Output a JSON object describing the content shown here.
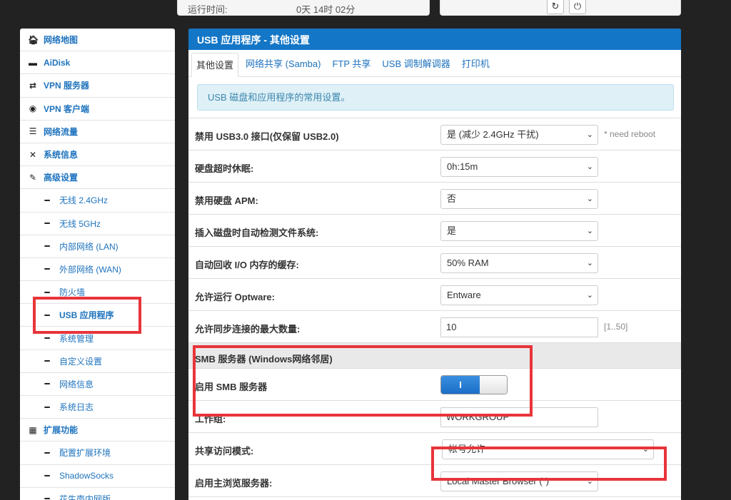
{
  "status": {
    "uptime_label": "运行时间:",
    "uptime_value": "0天 14时 02分",
    "refresh_icon": "↻",
    "power_icon": "⏻"
  },
  "sidebar": {
    "items": [
      {
        "icon": "🏠︎",
        "label": "网络地图"
      },
      {
        "icon": "▬",
        "label": "AiDisk"
      },
      {
        "icon": "⇄",
        "label": "VPN 服务器"
      },
      {
        "icon": "◉",
        "label": "VPN 客户端"
      },
      {
        "icon": "☰",
        "label": "网络流量"
      },
      {
        "icon": "✕",
        "label": "系统信息"
      },
      {
        "icon": "✎",
        "label": "高级设置"
      },
      {
        "icon": "━",
        "label": "无线 2.4GHz"
      },
      {
        "icon": "━",
        "label": "无线 5GHz"
      },
      {
        "icon": "━",
        "label": "内部网络 (LAN)"
      },
      {
        "icon": "━",
        "label": "外部网络 (WAN)"
      },
      {
        "icon": "━",
        "label": "防火墙"
      },
      {
        "icon": "━",
        "label": "USB 应用程序"
      },
      {
        "icon": "━",
        "label": "系统管理"
      },
      {
        "icon": "━",
        "label": "自定义设置"
      },
      {
        "icon": "━",
        "label": "网络信息"
      },
      {
        "icon": "━",
        "label": "系统日志"
      },
      {
        "icon": "▦",
        "label": "扩展功能"
      },
      {
        "icon": "━",
        "label": "配置扩展环境"
      },
      {
        "icon": "━",
        "label": "ShadowSocks"
      },
      {
        "icon": "━",
        "label": "花生壳内网版"
      }
    ]
  },
  "main": {
    "title": "USB 应用程序 - 其他设置",
    "tabs": [
      "其他设置",
      "网络共享 (Samba)",
      "FTP 共享",
      "USB 调制解调器",
      "打印机"
    ],
    "info": "USB 磁盘和应用程序的常用设置。",
    "rows": [
      {
        "label": "禁用 USB3.0 接口(仅保留 USB2.0)",
        "value": "是 (减少 2.4GHz 干扰)",
        "hint": "* need reboot"
      },
      {
        "label": "硬盘超时休眠:",
        "value": "0h:15m"
      },
      {
        "label": "禁用硬盘 APM:",
        "value": "否"
      },
      {
        "label": "插入磁盘时自动检测文件系统:",
        "value": "是"
      },
      {
        "label": "自动回收 I/O 内存的缓存:",
        "value": "50% RAM"
      },
      {
        "label": "允许运行 Optware:",
        "value": "Entware"
      },
      {
        "label": "允许同步连接的最大数量:",
        "value": "10",
        "hint": "[1..50]"
      }
    ],
    "smb_section": "SMB 服务器 (Windows网络邻居)",
    "smb_enable_label": "启用 SMB 服务器",
    "smb_enable_state": "I",
    "workgroup_label": "工作组:",
    "workgroup_value": "WORKGROUP",
    "access_mode_label": "共享访问模式:",
    "access_mode_value": "帐号允许",
    "master_browser_label": "启用主浏览服务器:",
    "master_browser_value": "Local Master Browser (*)",
    "chevron": "⌄"
  },
  "colors": {
    "header": "#1476c6",
    "link": "#1e73be",
    "highlight": "#e8343a"
  }
}
